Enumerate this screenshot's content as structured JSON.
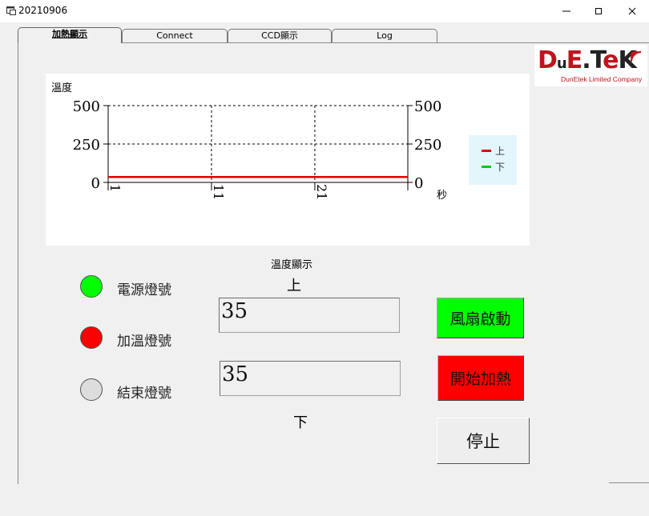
{
  "window": {
    "title": "20210906"
  },
  "tabs": [
    {
      "label": "加熱顯示",
      "active": true
    },
    {
      "label": "Connect",
      "active": false
    },
    {
      "label": "CCD顯示",
      "active": false
    },
    {
      "label": "Log",
      "active": false
    }
  ],
  "logo": {
    "main": "DuE.TeK",
    "sub": "DunEtek Limited Company"
  },
  "chart": {
    "title": "溫度",
    "x_unit": "秒"
  },
  "chart_data": {
    "type": "line",
    "title": "溫度",
    "xlabel": "秒",
    "ylabel": "",
    "x_ticks": [
      "1",
      "11",
      "21"
    ],
    "y_ticks": [
      0,
      250,
      500
    ],
    "ylim": [
      0,
      500
    ],
    "xlim": [
      1,
      30
    ],
    "grid": true,
    "legend_position": "right",
    "series": [
      {
        "name": "上",
        "color": "#e60000",
        "x": [
          1,
          11,
          11,
          30
        ],
        "values": [
          35,
          35,
          35,
          35
        ]
      },
      {
        "name": "下",
        "color": "#00cc00",
        "x": [],
        "values": []
      }
    ]
  },
  "lamps": [
    {
      "label": "電源燈號",
      "color": "#00ff00"
    },
    {
      "label": "加溫燈號",
      "color": "#ff0000"
    },
    {
      "label": "結束燈號",
      "color": "#dddddd"
    }
  ],
  "temperature": {
    "heading": "溫度顯示",
    "upper_label": "上",
    "upper_value": "35",
    "lower_label": "下",
    "lower_value": "35"
  },
  "buttons": {
    "fan": "風扇啟動",
    "heat": "開始加熱",
    "stop": "停止"
  }
}
